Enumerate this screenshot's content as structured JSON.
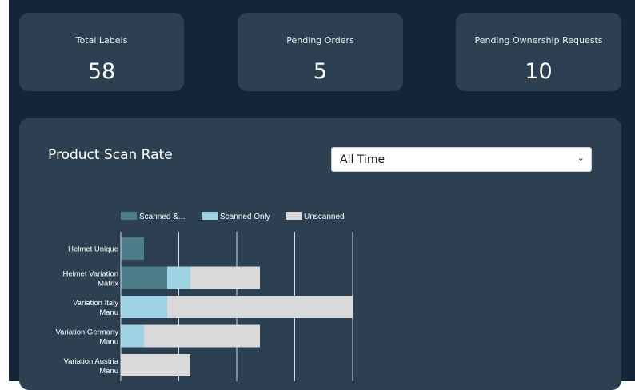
{
  "stats": [
    {
      "label": "Total Labels",
      "value": "58"
    },
    {
      "label": "Pending Orders",
      "value": "5"
    },
    {
      "label": "Pending Ownership Requests",
      "value": "10"
    }
  ],
  "scan_panel": {
    "title": "Product Scan Rate",
    "filter_selected": "All Time",
    "chevron_icon": "chevron-down-icon"
  },
  "colors": {
    "scanned_registered": "#4e7d8a",
    "scanned_only": "#9ed3e3",
    "unscanned": "#d9d9d9",
    "grid": "#d9d9d9",
    "label_text": "#ffffff"
  },
  "chart_data": {
    "type": "bar",
    "orientation": "horizontal",
    "stacked": true,
    "legend_position": "top",
    "categories": [
      [
        "Helmet Unique"
      ],
      [
        "Helmet Variation",
        "Matrix"
      ],
      [
        "Variation Italy",
        "Manu"
      ],
      [
        "Variation Germany",
        "Manu"
      ],
      [
        "Variation Austria",
        "Manu"
      ]
    ],
    "series": [
      {
        "name": "Scanned &...",
        "values": [
          1,
          2,
          0,
          0,
          0
        ]
      },
      {
        "name": "Scanned Only",
        "values": [
          0,
          1,
          2,
          1,
          0
        ]
      },
      {
        "name": "Unscanned",
        "values": [
          0,
          3,
          8,
          5,
          3
        ]
      }
    ],
    "xlim": [
      0,
      10
    ],
    "grid": true
  }
}
